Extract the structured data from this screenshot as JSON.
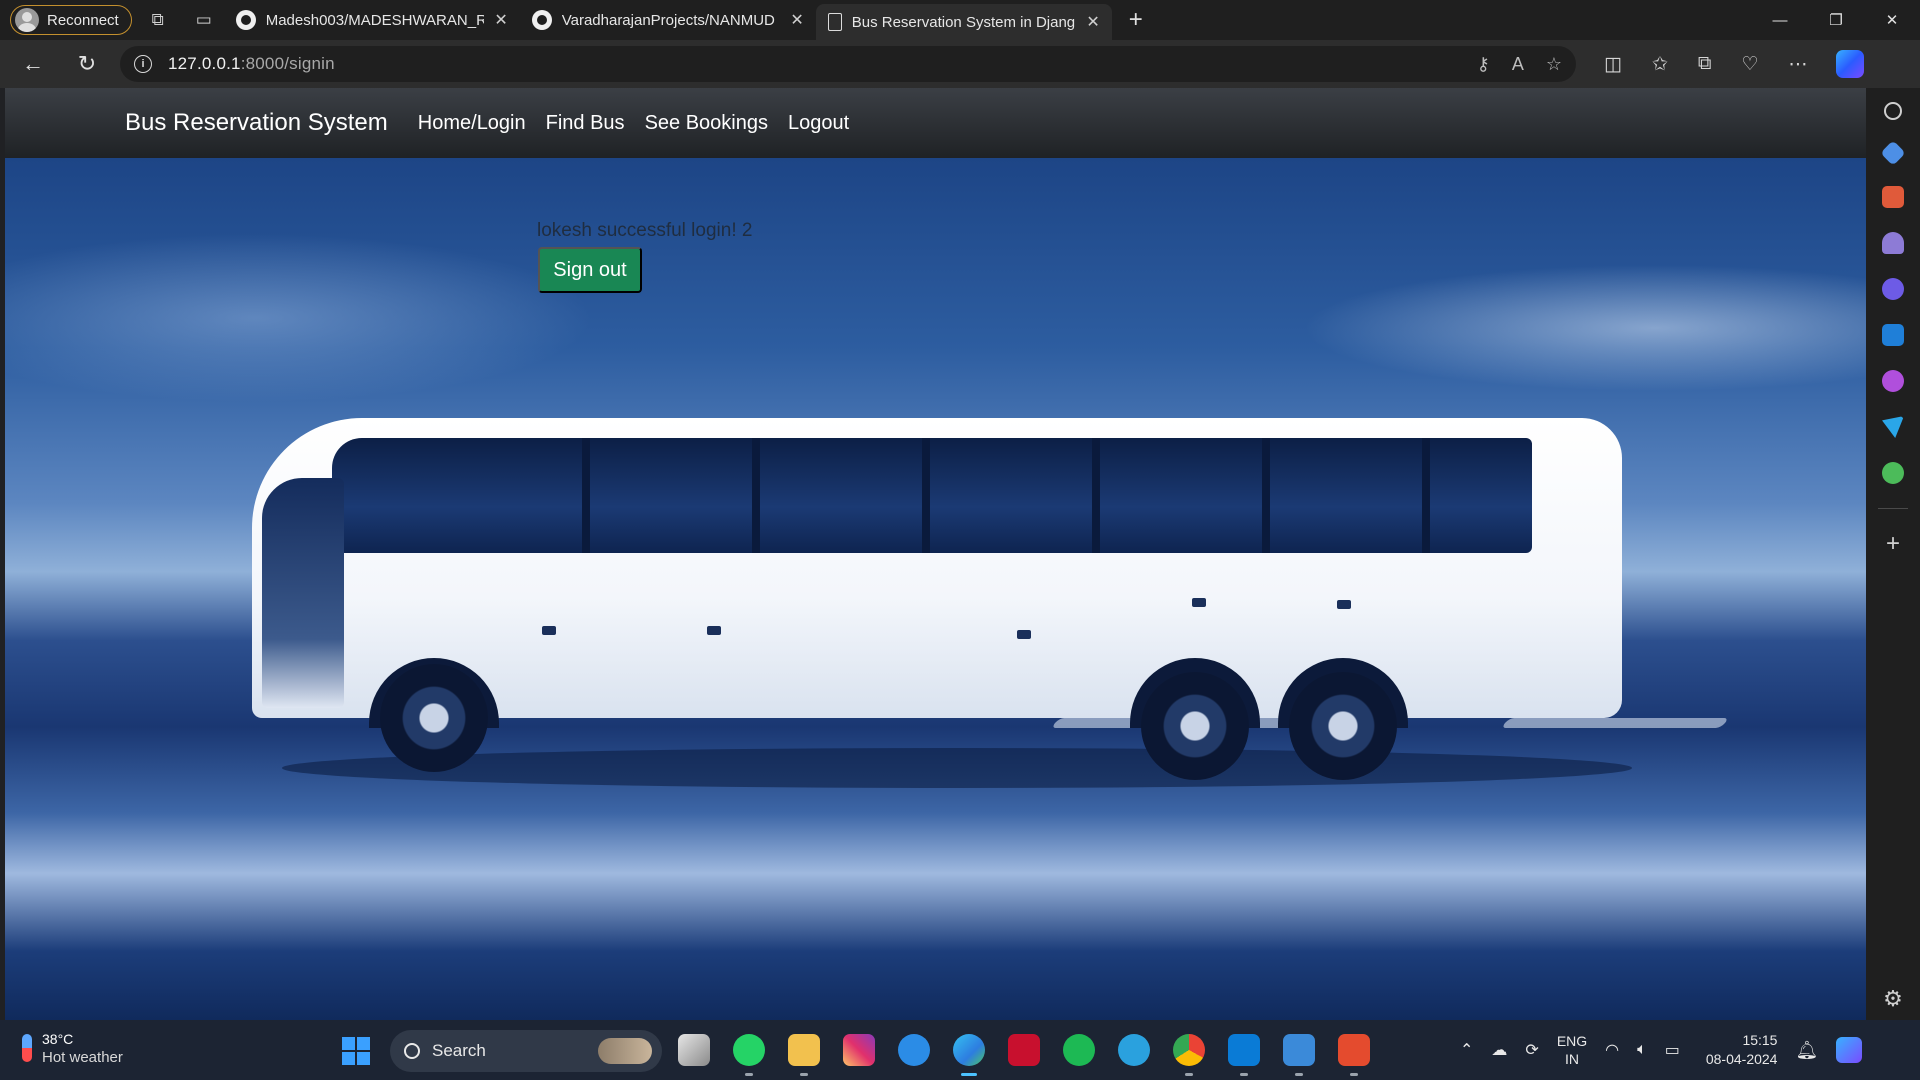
{
  "browser": {
    "profile_label": "Reconnect",
    "tabs": [
      {
        "title": "Madesh003/MADESHWARAN_R",
        "icon": "github-icon",
        "active": false
      },
      {
        "title": "VaradharajanProjects/NANMUD",
        "icon": "github-icon",
        "active": false
      },
      {
        "title": "Bus Reservation System in Djang",
        "icon": "document-icon",
        "active": true
      }
    ],
    "url_host": "127.0.0.1",
    "url_path": ":8000/signin"
  },
  "page": {
    "brand": "Bus Reservation System",
    "nav": [
      "Home/Login",
      "Find Bus",
      "See Bookings",
      "Logout"
    ],
    "message": "lokesh successful login! 2",
    "signout_label": "Sign out",
    "signout_color": "#198754"
  },
  "taskbar": {
    "temperature": "38°C",
    "weather": "Hot weather",
    "search_label": "Search",
    "language": "ENG",
    "region": "IN",
    "time": "15:15",
    "date": "08-04-2024"
  }
}
